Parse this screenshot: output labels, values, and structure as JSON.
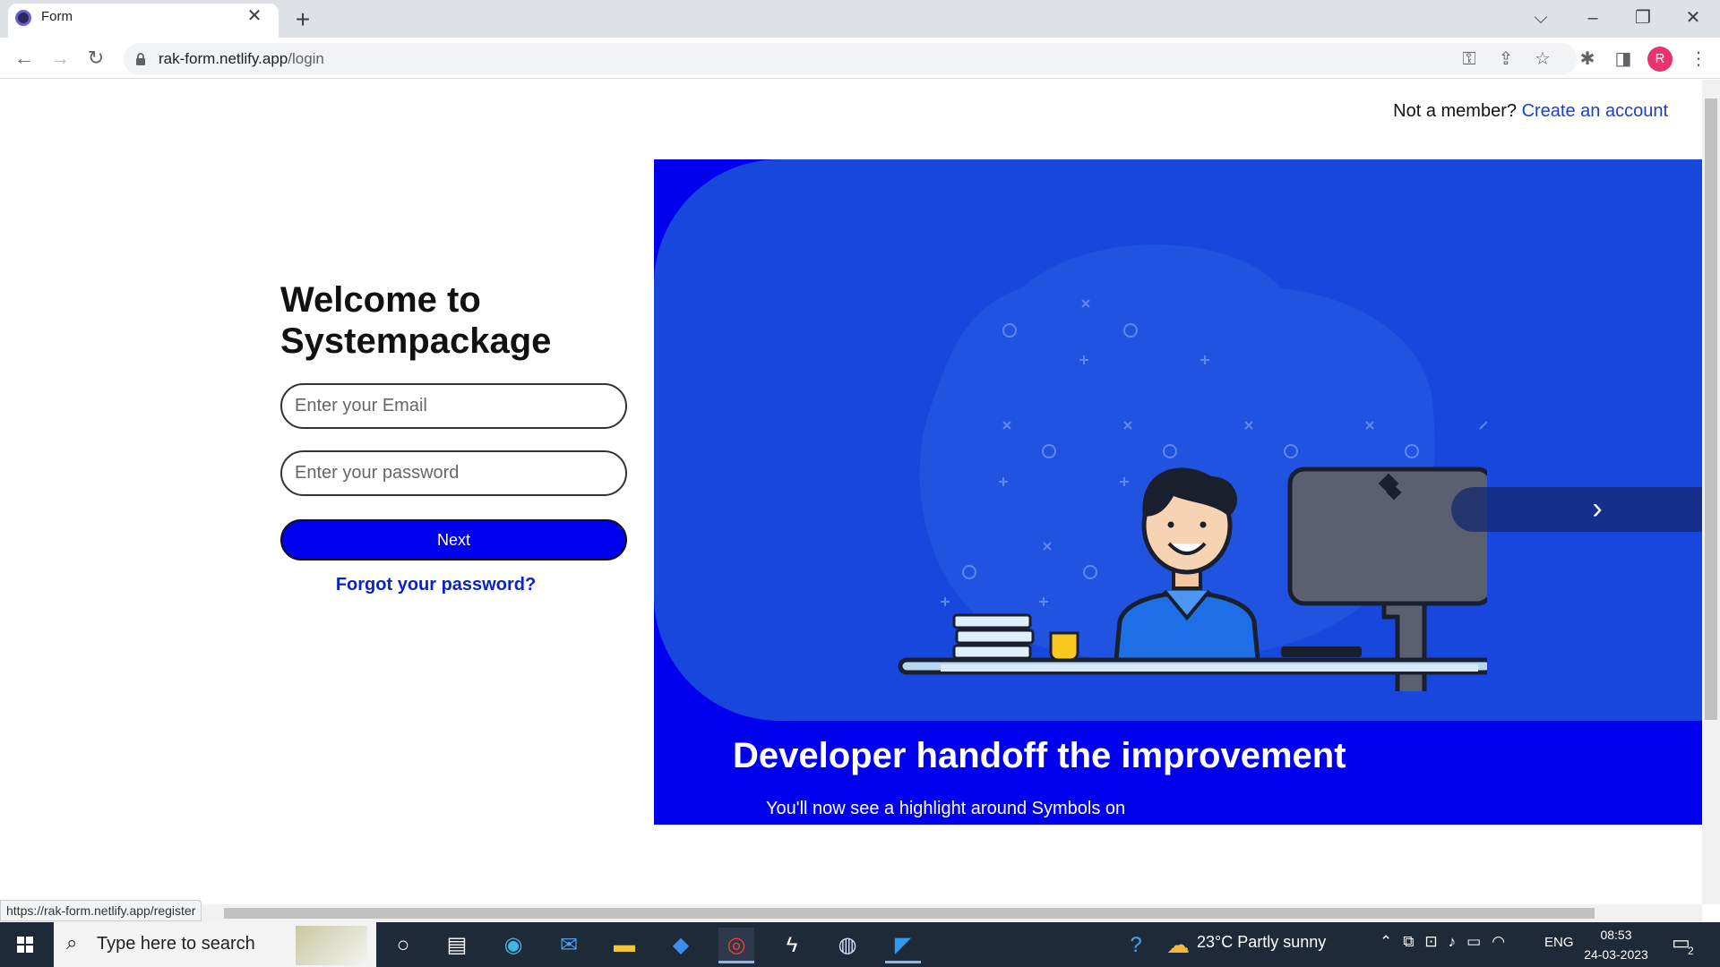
{
  "browser": {
    "tab_title": "Form",
    "url_host": "rak-form.netlify.app",
    "url_path": "/login",
    "profile_initial": "R",
    "status_url": "https://rak-form.netlify.app/register"
  },
  "page": {
    "not_member_text": "Not a member?",
    "create_account_link": "Create an account",
    "welcome_line1": "Welcome to",
    "welcome_line2": "Systempackage",
    "email_placeholder": "Enter your Email",
    "password_placeholder": "Enter your password",
    "next_label": "Next",
    "forgot_label": "Forgot your password?",
    "hero_heading": "Developer handoff the improvement",
    "hero_text": "You'll now see a highlight around Symbols on"
  },
  "taskbar": {
    "search_placeholder": "Type here to search",
    "weather": "23°C  Partly sunny",
    "language": "ENG",
    "time": "08:53",
    "date": "24-03-2023",
    "notification_count": "2"
  },
  "colors": {
    "hero_bg": "#0000ee",
    "hero_panel": "#1847dd",
    "next_button": "#0000f0",
    "link": "#1a3fd0"
  }
}
